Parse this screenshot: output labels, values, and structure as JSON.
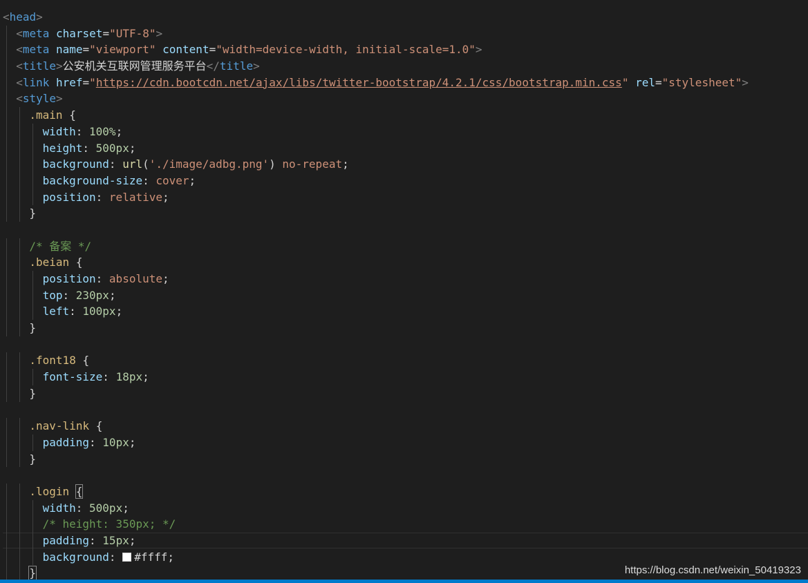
{
  "editor": {
    "title_text": "公安机关互联网管理服务平台",
    "meta_charset": "UTF-8",
    "viewport_name": "viewport",
    "viewport_content": "width=device-width, initial-scale=1.0",
    "css_href": "https://cdn.bootcdn.net/ajax/libs/twitter-bootstrap/4.2.1/css/bootstrap.min.css",
    "rel_value": "stylesheet"
  },
  "lines": [
    {
      "indent": 0,
      "tokens": [
        [
          "br",
          "<"
        ],
        [
          "tag",
          "head"
        ],
        [
          "br",
          ">"
        ]
      ]
    },
    {
      "indent": 1,
      "tokens": [
        [
          "br",
          "<"
        ],
        [
          "tag",
          "meta"
        ],
        [
          "txt",
          " "
        ],
        [
          "attr",
          "charset"
        ],
        [
          "pun",
          "="
        ],
        [
          "str",
          "\"UTF-8\""
        ],
        [
          "br",
          ">"
        ]
      ]
    },
    {
      "indent": 1,
      "tokens": [
        [
          "br",
          "<"
        ],
        [
          "tag",
          "meta"
        ],
        [
          "txt",
          " "
        ],
        [
          "attr",
          "name"
        ],
        [
          "pun",
          "="
        ],
        [
          "str",
          "\"viewport\""
        ],
        [
          "txt",
          " "
        ],
        [
          "attr",
          "content"
        ],
        [
          "pun",
          "="
        ],
        [
          "str",
          "\"width=device-width, initial-scale=1.0\""
        ],
        [
          "br",
          ">"
        ]
      ]
    },
    {
      "indent": 1,
      "tokens": [
        [
          "br",
          "<"
        ],
        [
          "tag",
          "title"
        ],
        [
          "br",
          ">"
        ],
        [
          "txt",
          "公安机关互联网管理服务平台"
        ],
        [
          "br",
          "</"
        ],
        [
          "tag",
          "title"
        ],
        [
          "br",
          ">"
        ]
      ]
    },
    {
      "indent": 1,
      "tokens": [
        [
          "br",
          "<"
        ],
        [
          "tag",
          "link"
        ],
        [
          "txt",
          " "
        ],
        [
          "attr",
          "href"
        ],
        [
          "pun",
          "="
        ],
        [
          "str",
          "\""
        ],
        [
          "url",
          "https://cdn.bootcdn.net/ajax/libs/twitter-bootstrap/4.2.1/css/bootstrap.min.css"
        ],
        [
          "str",
          "\""
        ],
        [
          "txt",
          " "
        ],
        [
          "attr",
          "rel"
        ],
        [
          "pun",
          "="
        ],
        [
          "str",
          "\"stylesheet\""
        ],
        [
          "br",
          ">"
        ]
      ]
    },
    {
      "indent": 1,
      "tokens": [
        [
          "br",
          "<"
        ],
        [
          "tag",
          "style"
        ],
        [
          "br",
          ">"
        ]
      ]
    },
    {
      "indent": 2,
      "tokens": [
        [
          "sel",
          ".main"
        ],
        [
          "pun",
          " {"
        ]
      ]
    },
    {
      "indent": 3,
      "tokens": [
        [
          "prop",
          "width"
        ],
        [
          "pun",
          ": "
        ],
        [
          "num",
          "100%"
        ],
        [
          "pun",
          ";"
        ]
      ]
    },
    {
      "indent": 3,
      "tokens": [
        [
          "prop",
          "height"
        ],
        [
          "pun",
          ": "
        ],
        [
          "num",
          "500px"
        ],
        [
          "pun",
          ";"
        ]
      ]
    },
    {
      "indent": 3,
      "tokens": [
        [
          "prop",
          "background"
        ],
        [
          "pun",
          ": "
        ],
        [
          "fn",
          "url"
        ],
        [
          "pun",
          "("
        ],
        [
          "str",
          "'./image/adbg.png'"
        ],
        [
          "pun",
          ") "
        ],
        [
          "kw",
          "no-repeat"
        ],
        [
          "pun",
          ";"
        ]
      ]
    },
    {
      "indent": 3,
      "tokens": [
        [
          "prop",
          "background-size"
        ],
        [
          "pun",
          ": "
        ],
        [
          "kw",
          "cover"
        ],
        [
          "pun",
          ";"
        ]
      ]
    },
    {
      "indent": 3,
      "tokens": [
        [
          "prop",
          "position"
        ],
        [
          "pun",
          ": "
        ],
        [
          "kw",
          "relative"
        ],
        [
          "pun",
          ";"
        ]
      ]
    },
    {
      "indent": 2,
      "tokens": [
        [
          "pun",
          "}"
        ]
      ]
    },
    {
      "indent": 0,
      "tokens": []
    },
    {
      "indent": 2,
      "tokens": [
        [
          "cm",
          "/* 备案 */"
        ]
      ]
    },
    {
      "indent": 2,
      "tokens": [
        [
          "sel",
          ".beian"
        ],
        [
          "pun",
          " {"
        ]
      ]
    },
    {
      "indent": 3,
      "tokens": [
        [
          "prop",
          "position"
        ],
        [
          "pun",
          ": "
        ],
        [
          "kw",
          "absolute"
        ],
        [
          "pun",
          ";"
        ]
      ]
    },
    {
      "indent": 3,
      "tokens": [
        [
          "prop",
          "top"
        ],
        [
          "pun",
          ": "
        ],
        [
          "num",
          "230px"
        ],
        [
          "pun",
          ";"
        ]
      ]
    },
    {
      "indent": 3,
      "tokens": [
        [
          "prop",
          "left"
        ],
        [
          "pun",
          ": "
        ],
        [
          "num",
          "100px"
        ],
        [
          "pun",
          ";"
        ]
      ]
    },
    {
      "indent": 2,
      "tokens": [
        [
          "pun",
          "}"
        ]
      ]
    },
    {
      "indent": 0,
      "tokens": []
    },
    {
      "indent": 2,
      "tokens": [
        [
          "sel",
          ".font18"
        ],
        [
          "pun",
          " {"
        ]
      ]
    },
    {
      "indent": 3,
      "tokens": [
        [
          "prop",
          "font-size"
        ],
        [
          "pun",
          ": "
        ],
        [
          "num",
          "18px"
        ],
        [
          "pun",
          ";"
        ]
      ]
    },
    {
      "indent": 2,
      "tokens": [
        [
          "pun",
          "}"
        ]
      ]
    },
    {
      "indent": 0,
      "tokens": []
    },
    {
      "indent": 2,
      "tokens": [
        [
          "sel",
          ".nav-link"
        ],
        [
          "pun",
          " {"
        ]
      ]
    },
    {
      "indent": 3,
      "tokens": [
        [
          "prop",
          "padding"
        ],
        [
          "pun",
          ": "
        ],
        [
          "num",
          "10px"
        ],
        [
          "pun",
          ";"
        ]
      ]
    },
    {
      "indent": 2,
      "tokens": [
        [
          "pun",
          "}"
        ]
      ]
    },
    {
      "indent": 0,
      "tokens": []
    },
    {
      "indent": 2,
      "tokens": [
        [
          "sel",
          ".login"
        ],
        [
          "pun",
          " "
        ],
        [
          "hl",
          "{"
        ]
      ]
    },
    {
      "indent": 3,
      "tokens": [
        [
          "prop",
          "width"
        ],
        [
          "pun",
          ": "
        ],
        [
          "num",
          "500px"
        ],
        [
          "pun",
          ";"
        ]
      ]
    },
    {
      "indent": 3,
      "tokens": [
        [
          "cm",
          "/* height: 350px; */"
        ]
      ]
    },
    {
      "indent": 3,
      "current": true,
      "tokens": [
        [
          "prop",
          "padding"
        ],
        [
          "pun",
          ": "
        ],
        [
          "num",
          "15px"
        ],
        [
          "pun",
          ";"
        ]
      ]
    },
    {
      "indent": 3,
      "tokens": [
        [
          "prop",
          "background"
        ],
        [
          "pun",
          ": "
        ],
        [
          "swatch",
          ""
        ],
        [
          "txt",
          "#ffff"
        ],
        [
          "pun",
          ";"
        ]
      ]
    },
    {
      "indent": 2,
      "tokens": [
        [
          "hl",
          "}"
        ]
      ]
    }
  ],
  "watermark": "https://blog.csdn.net/weixin_50419323",
  "colors": {
    "background": "#1e1e1e",
    "tag": "#569cd6",
    "attribute": "#9cdcfe",
    "string": "#ce9178",
    "selector": "#d7ba7d",
    "number": "#b5cea8",
    "comment": "#6a9955",
    "function": "#dcdcaa",
    "status_bar": "#007acc"
  }
}
